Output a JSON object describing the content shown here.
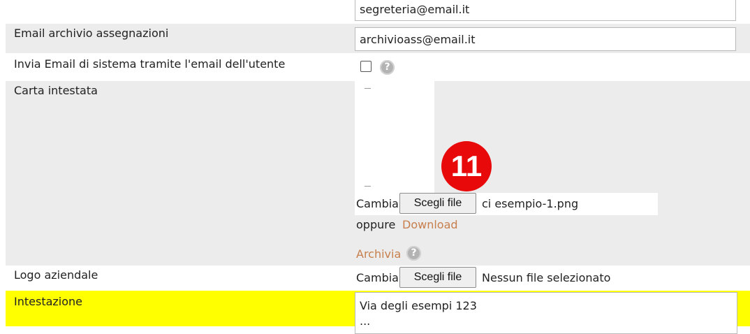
{
  "form": {
    "rows": [
      {
        "label": "",
        "value": "segreteria@email.it"
      },
      {
        "label": "Email archivio assegnazioni",
        "value": "archivioass@email.it"
      },
      {
        "label": "Invia Email di sistema tramite l'email dell'utente",
        "checked": false,
        "help": "?"
      },
      {
        "label": "Carta intestata",
        "change_label": "Cambia",
        "choose_file_label": "Scegli file",
        "file_name": "ci esempio-1.png",
        "or_label": "oppure",
        "download_label": "Download",
        "archive_label": "Archivia",
        "help": "?"
      },
      {
        "label": "Logo aziendale",
        "change_label": "Cambia",
        "choose_file_label": "Scegli file",
        "file_name": "Nessun file selezionato"
      },
      {
        "label": "Intestazione",
        "value": "Via degli esempi 123\n..."
      }
    ]
  },
  "annotation": {
    "number": "11",
    "color": "#e8090b"
  },
  "colors": {
    "row_grey": "#ececec",
    "highlight": "#ffff00",
    "link": "#c77f4d"
  }
}
